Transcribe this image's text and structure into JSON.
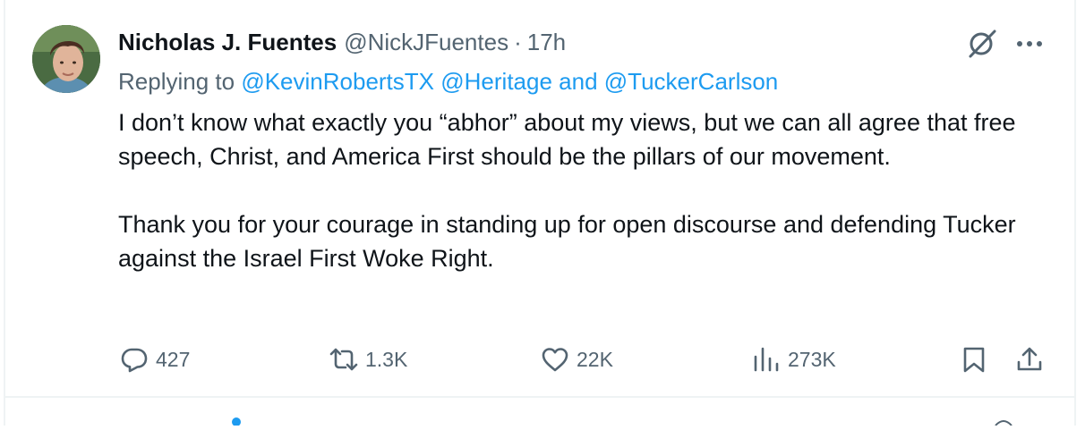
{
  "tweet": {
    "author_name": "Nicholas J. Fuentes",
    "author_handle": "@NickJFuentes",
    "separator": "·",
    "time": "17h",
    "replying_to_label": "Replying to",
    "mention_1": "@KevinRobertsTX",
    "mention_2": "@Heritage",
    "and_label": "and",
    "mention_3": "@TuckerCarlson",
    "paragraph_1": "I don’t know what exactly you “abhor” about my views, but we can all agree that free speech, Christ, and America First should be the pillars of our movement.",
    "paragraph_2": "Thank you for your courage in standing up for open discourse and defending Tucker against the Israel First Woke Right."
  },
  "actions": {
    "replies": "427",
    "reposts": "1.3K",
    "likes": "22K",
    "views": "273K"
  },
  "icons": {
    "reply": "reply-icon",
    "repost": "repost-icon",
    "like": "heart-icon",
    "views": "views-icon",
    "bookmark": "bookmark-icon",
    "share": "share-icon",
    "grok": "grok-icon",
    "more": "more-icon"
  },
  "colors": {
    "link": "#1d9bf0",
    "secondary_text": "#536471",
    "primary_text": "#0f1419"
  }
}
